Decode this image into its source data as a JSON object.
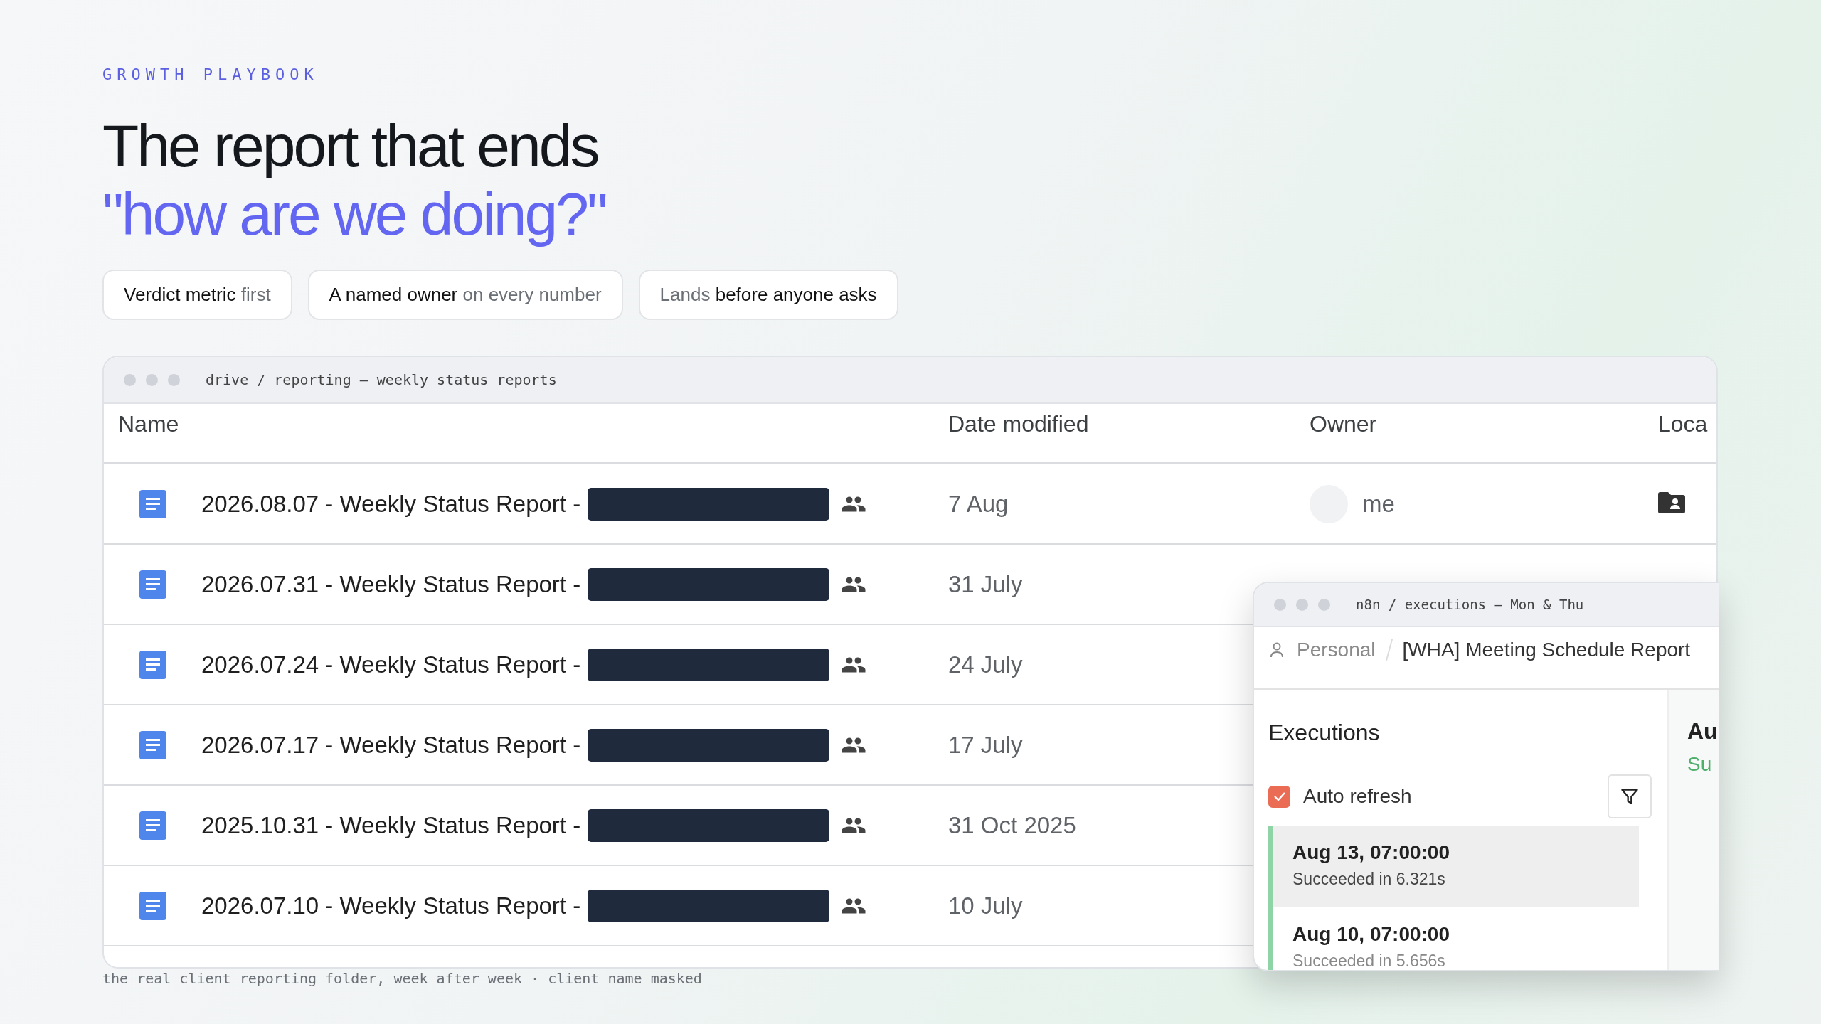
{
  "eyebrow": "GROWTH PLAYBOOK",
  "headline": {
    "line_1": "The report that ends",
    "line_2": "\"how are we doing?\""
  },
  "pills": [
    "**Verdict metric** first",
    "**A named owner** on every number",
    "Lands **before anyone asks**"
  ],
  "drive_window": {
    "title": "drive / reporting — weekly status reports",
    "columns": [
      "Name",
      "Date modified",
      "Owner",
      "Loca"
    ],
    "rows": [
      {
        "name": "2026.08.07 - Weekly Status Report -",
        "modified": "7 Aug",
        "owner": "me",
        "location": true
      },
      {
        "name": "2026.07.31 - Weekly Status Report -",
        "modified": "31 July",
        "location": false
      },
      {
        "name": "2026.07.24 - Weekly Status Report -",
        "modified": "24 July",
        "location": false
      },
      {
        "name": "2026.07.17 - Weekly Status Report -",
        "modified": "17 July",
        "location": false
      },
      {
        "name": "2025.10.31 - Weekly Status Report -",
        "modified": "31 Oct 2025",
        "location": false
      },
      {
        "name": "2026.07.10 - Weekly Status Report -",
        "modified": "10 July",
        "location": false
      }
    ]
  },
  "n8n_window": {
    "title": "n8n / executions — Mon & Thu",
    "breadcrumb": {
      "project": "Personal",
      "workflow": "[WHA] Meeting Schedule Report"
    },
    "heading": "Executions",
    "auto_refresh": {
      "label": "Auto refresh",
      "checked": true
    },
    "executions": [
      {
        "time": "Aug 13, 07:00:00",
        "status": "Succeeded in 6.321s",
        "selected": true
      },
      {
        "time": "Aug 10, 07:00:00",
        "status": "Succeeded in 5.656s",
        "selected": false
      }
    ],
    "detail": {
      "title": "Au",
      "status": "Su"
    }
  },
  "caption": "the real client reporting folder, week after week · client name masked"
}
